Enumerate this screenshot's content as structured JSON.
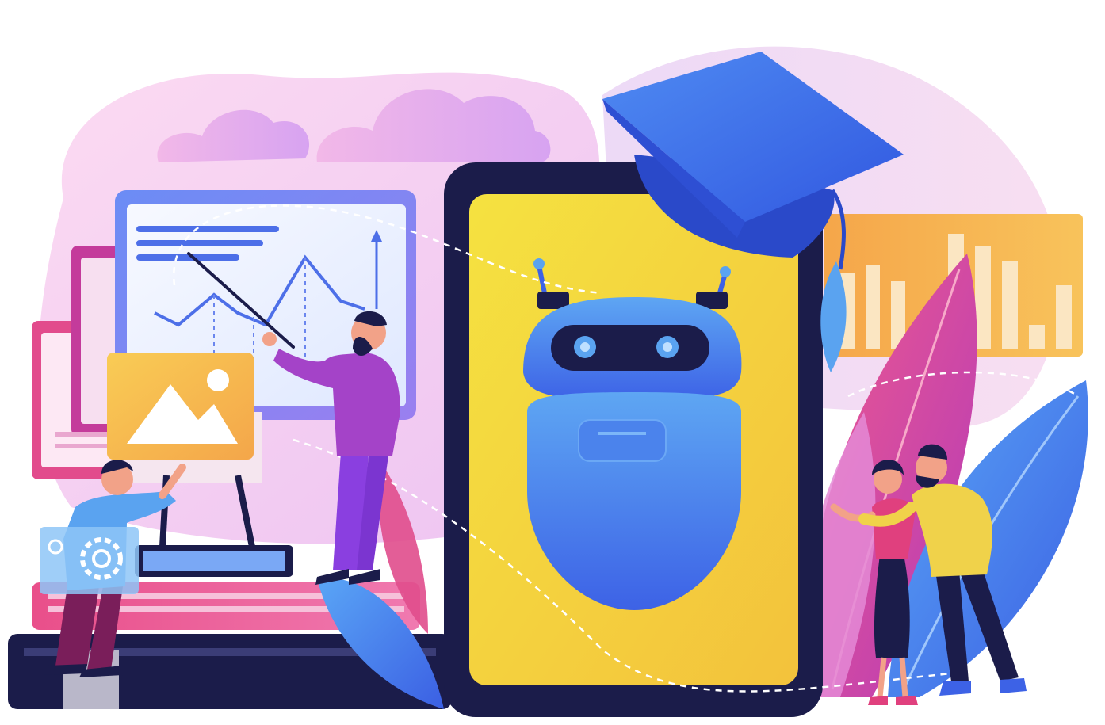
{
  "scene": {
    "subject": "chatbot-education-illustration",
    "icons": [
      "cloud-icon",
      "graduation-cap-icon",
      "robot-icon",
      "image-icon",
      "gear-icon",
      "line-chart-icon",
      "bar-chart-icon",
      "leaf-icon",
      "book-icon"
    ],
    "palette": {
      "background": "#ffffff",
      "blob_pink": "#f7c6ea",
      "blob_lavender": "#e6c8f2",
      "cloud": "#d9a6ee",
      "phone_frame": "#1b1c4a",
      "phone_screen": "#f4e443",
      "robot_blue": "#3d6be8",
      "robot_light": "#5aa3f0",
      "cap_blue": "#3e67e6",
      "board_frame": "#5a7df2",
      "board_screen": "#eef4ff",
      "orange": "#f1a04a",
      "magenta": "#e0407e",
      "purple": "#a443c8",
      "yellow_shirt": "#f0d24a"
    }
  }
}
